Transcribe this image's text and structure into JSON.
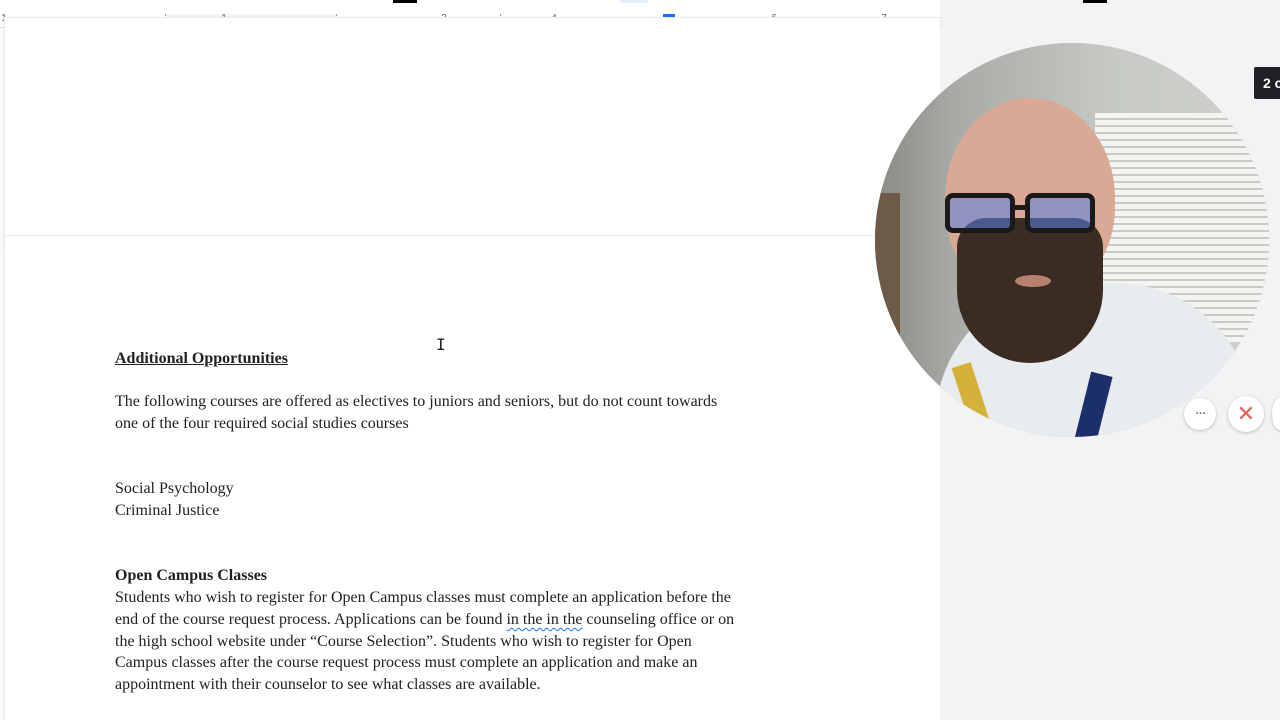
{
  "ruler": {
    "numbers": [
      "1",
      "1",
      "3",
      "4",
      "6",
      "7"
    ]
  },
  "document": {
    "heading_additional": "Additional Opportunities",
    "para_intro_line1": "The following courses are offered as electives to juniors and seniors, but do not count towards",
    "para_intro_line2": "one of the four required social studies courses",
    "course_1": "Social Psychology",
    "course_2": "Criminal Justice",
    "heading_open_campus": "Open Campus Classes",
    "open_line1": "Students who wish to register for Open Campus classes must complete an application before the",
    "open_line2_a": "end of the course request process. Applications can be found ",
    "open_line2_spell": "in the in the",
    "open_line2_b": " counseling office or on",
    "open_line3": "the high school website under “Course Selection”. Students who wish to register for Open",
    "open_line4": "Campus classes after the course request process must complete an application and make an",
    "open_line5": "appointment with their counselor to see what classes are available."
  },
  "cursor": {
    "glyph": "I"
  },
  "webcam": {
    "more_icon": "···",
    "close_icon": "✕"
  },
  "badge": {
    "text": "2 c"
  },
  "colors": {
    "accent": "#1a73e8",
    "close": "#e06055",
    "text": "#202124"
  }
}
